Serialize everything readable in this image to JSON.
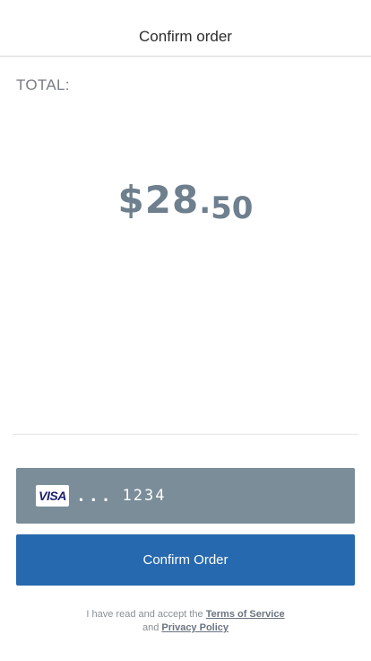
{
  "header": {
    "title": "Confirm order"
  },
  "total": {
    "label": "TOTAL:",
    "currency": "$",
    "dollars": "28",
    "separator": ".",
    "cents": "50"
  },
  "payment": {
    "card_brand": "VISA",
    "card_icon": "visa-card-icon",
    "masked_dots": "...",
    "last4": "1234"
  },
  "actions": {
    "confirm_label": "Confirm Order"
  },
  "terms": {
    "prefix": "I have read and accept the",
    "terms_link": "Terms of Service",
    "conjunction": "and",
    "privacy_link": "Privacy Policy"
  },
  "colors": {
    "primary": "#2769ae",
    "card_background": "#7a8d99",
    "amount_text": "#6e7f8e"
  }
}
